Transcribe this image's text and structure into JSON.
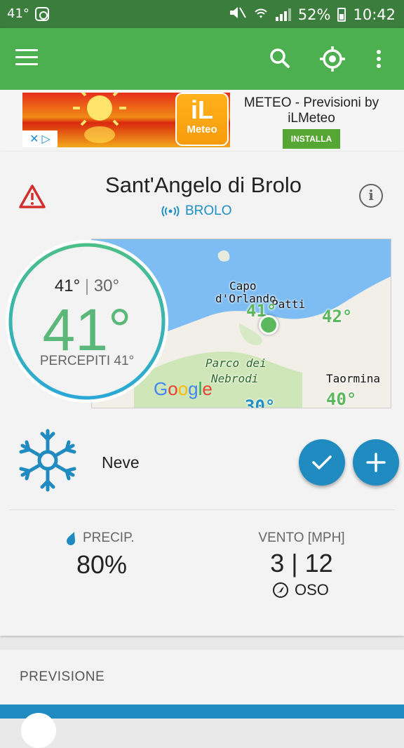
{
  "status_bar": {
    "left_temp": "41°",
    "battery": "52%",
    "time": "10:42"
  },
  "ad": {
    "logo_big": "iL",
    "logo_small": "Meteo",
    "title": "METEO - Previsioni by iLMeteo",
    "install": "INSTALLA"
  },
  "location": {
    "city": "Sant'Angelo di Brolo",
    "station": "BROLO"
  },
  "temperature": {
    "max": "41°",
    "min": "30°",
    "current": "41°",
    "feels_like": "PERCEPITI 41°"
  },
  "map": {
    "labels": {
      "capo": "Capo",
      "orlando": "d'Orlando",
      "patti": "Patti",
      "parco": "Parco dei",
      "nebrodi": "Nebrodi",
      "taormina": "Taormina"
    },
    "temps": {
      "t1": "41°",
      "t2": "42°",
      "t3": "30°",
      "t4": "40°"
    },
    "google": "Google"
  },
  "condition": {
    "label": "Neve"
  },
  "precip": {
    "label": "PRECIP.",
    "value": "80%"
  },
  "wind": {
    "label": "VENTO [MPH]",
    "value": "3 | 12",
    "direction": "OSO"
  },
  "forecast_section": {
    "header": "PREVISIONE"
  },
  "colors": {
    "appbar": "#4caf50",
    "statusbar": "#3b7d3c",
    "accent_blue": "#1f8bc0",
    "temp_green": "#5cb87a"
  }
}
